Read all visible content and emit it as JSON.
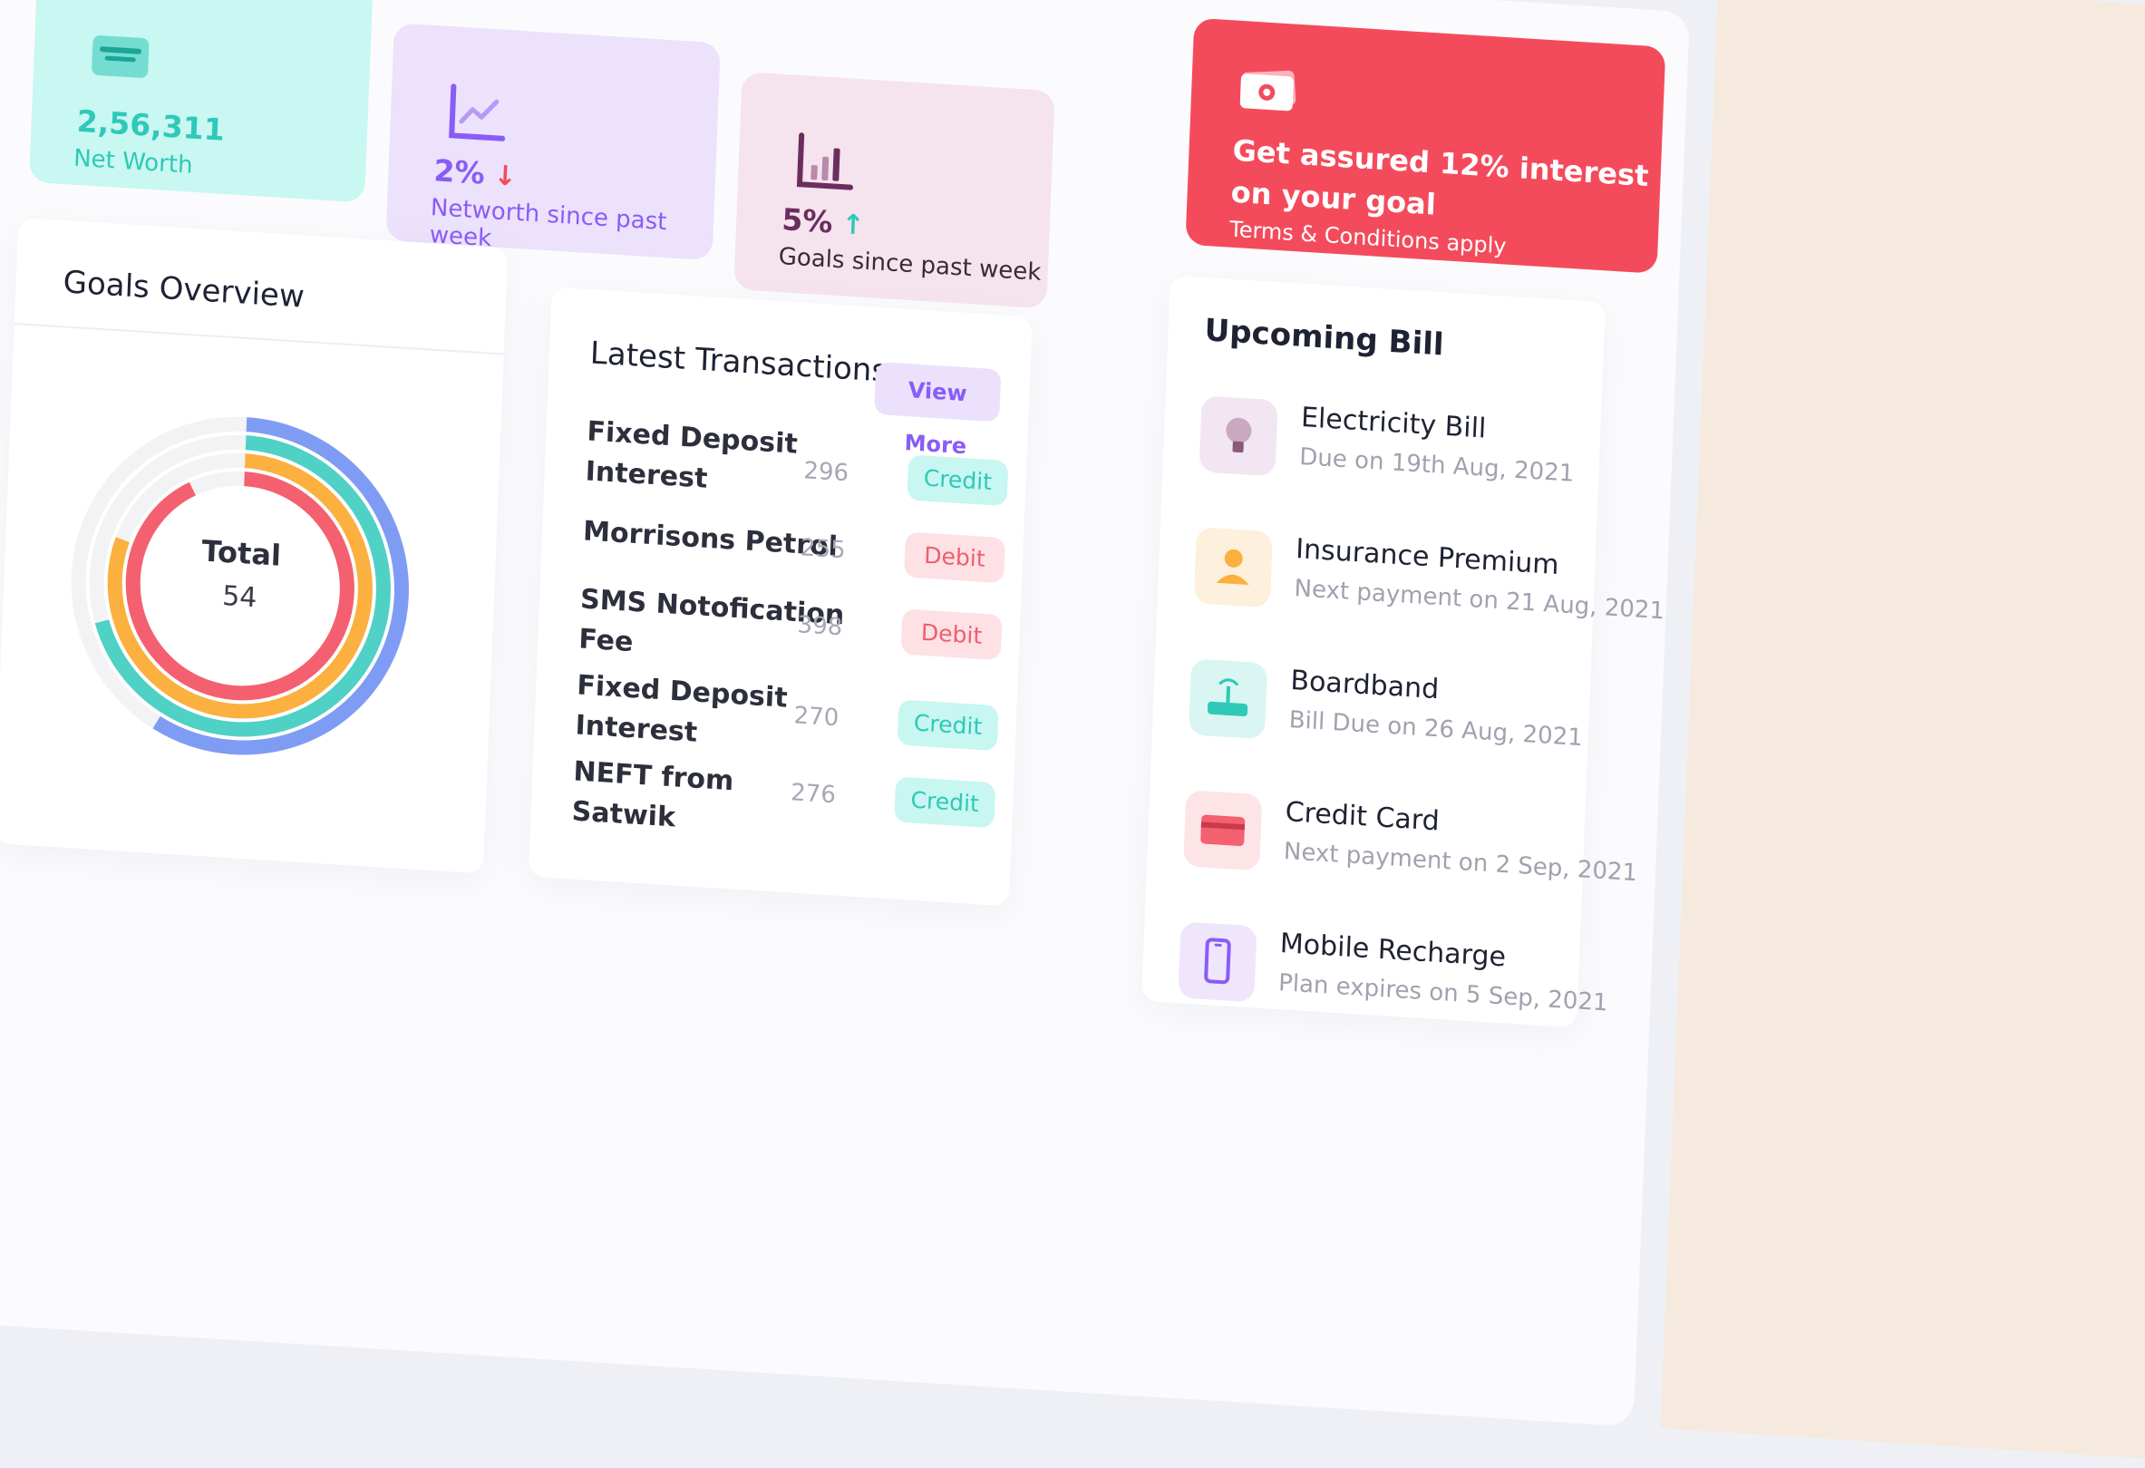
{
  "stats": [
    {
      "value": "2,56,311",
      "label": "Net Worth",
      "icon": "wallet-icon",
      "color": "#2ec9b8",
      "bg": "#c9f7f1"
    },
    {
      "value": "2%",
      "label": "Networth since past week",
      "icon": "line-chart-icon",
      "trend": "down",
      "color": "#8a5cf6",
      "bg": "#ece2fc"
    },
    {
      "value": "5%",
      "label": "Goals since past week",
      "icon": "bar-chart-icon",
      "trend": "up",
      "color": "#6b2d5e",
      "bg": "#f5e3ee"
    }
  ],
  "promo": {
    "title": "Get assured 12% interest on your goal",
    "terms": "Terms & Conditions apply",
    "icon": "cash-icon",
    "bg": "#f44b5c"
  },
  "goals": {
    "title": "Goals Overview",
    "total_label": "Total",
    "total_value": "54",
    "rings": [
      {
        "color": "#7f9cf5",
        "fraction": 0.58
      },
      {
        "color": "#4fd1c5",
        "fraction": 0.7
      },
      {
        "color": "#fbb040",
        "fraction": 0.8
      },
      {
        "color": "#f4606f",
        "fraction": 0.92
      }
    ]
  },
  "transactions": {
    "title": "Latest Transactions",
    "view_more": "View More",
    "items": [
      {
        "name": "Fixed Deposit Interest",
        "amount": "296",
        "type": "Credit"
      },
      {
        "name": "Morrisons Petrol",
        "amount": "255",
        "type": "Debit"
      },
      {
        "name": "SMS Notofication Fee",
        "amount": "398",
        "type": "Debit"
      },
      {
        "name": "Fixed Deposit Interest",
        "amount": "270",
        "type": "Credit"
      },
      {
        "name": "NEFT from Satwik",
        "amount": "276",
        "type": "Credit"
      }
    ]
  },
  "bills": {
    "title": "Upcoming Bill",
    "items": [
      {
        "title": "Electricity Bill",
        "sub": "Due on 19th Aug, 2021",
        "icon": "bulb-icon",
        "bg": "#f2e6f2",
        "fg": "#8a5a7a"
      },
      {
        "title": "Insurance Premium",
        "sub": "Next payment on 21 Aug, 2021",
        "icon": "person-icon",
        "bg": "#fdf0dc",
        "fg": "#fbb040"
      },
      {
        "title": "Boardband",
        "sub": "Bill Due on 26 Aug, 2021",
        "icon": "router-icon",
        "bg": "#d9f6f2",
        "fg": "#2ec9b8"
      },
      {
        "title": "Credit Card",
        "sub": "Next payment on 2 Sep, 2021",
        "icon": "credit-card-icon",
        "bg": "#fde4e6",
        "fg": "#f4606f"
      },
      {
        "title": "Mobile Recharge",
        "sub": "Plan expires on 5 Sep, 2021",
        "icon": "phone-icon",
        "bg": "#efe6fc",
        "fg": "#8a5cf6"
      }
    ]
  }
}
